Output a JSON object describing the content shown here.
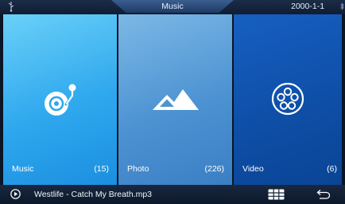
{
  "header": {
    "title": "Music",
    "date": "2000-1-1"
  },
  "tiles": [
    {
      "label": "Music",
      "count": "(15)",
      "icon": "vinyl-record-icon"
    },
    {
      "label": "Photo",
      "count": "(226)",
      "icon": "mountain-icon"
    },
    {
      "label": "Video",
      "count": "(6)",
      "icon": "film-reel-icon"
    }
  ],
  "footer": {
    "now_playing": "Westlife - Catch My Breath.mp3",
    "play_icon": "play-icon",
    "grid_icon": "grid-icon",
    "back_icon": "back-arrow-icon"
  },
  "colors": {
    "music_tile": "#2fa8ee",
    "photo_tile": "#4d93d2",
    "video_tile": "#0e4fa8",
    "bar_background": "#0f1d33"
  }
}
